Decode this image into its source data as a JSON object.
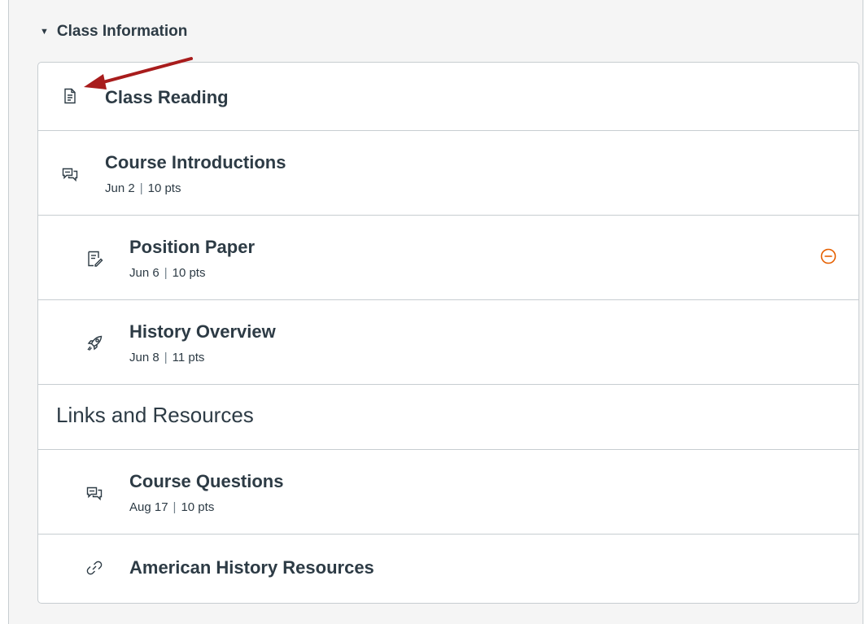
{
  "module": {
    "title": "Class Information",
    "collapse_icon": "caret-down-icon"
  },
  "items": {
    "class_reading": {
      "title": "Class Reading",
      "icon": "page-icon"
    },
    "course_introductions": {
      "title": "Course Introductions",
      "date": "Jun 2",
      "points": "10 pts",
      "icon": "discussion-icon"
    },
    "position_paper": {
      "title": "Position Paper",
      "date": "Jun 6",
      "points": "10 pts",
      "icon": "assignment-icon",
      "status_icon": "unpublish-icon",
      "status_color": "#e66000"
    },
    "history_overview": {
      "title": "History Overview",
      "date": "Jun 8",
      "points": "11 pts",
      "icon": "quiz-rocket-icon"
    },
    "links_header": {
      "title": "Links and Resources"
    },
    "course_questions": {
      "title": "Course Questions",
      "date": "Aug 17",
      "points": "10 pts",
      "icon": "discussion-icon"
    },
    "american_history": {
      "title": "American History Resources",
      "icon": "link-icon"
    }
  },
  "colors": {
    "text": "#2d3b45",
    "border": "#c7cdd1",
    "arrow": "#a81c1c",
    "background": "#f5f5f5"
  }
}
